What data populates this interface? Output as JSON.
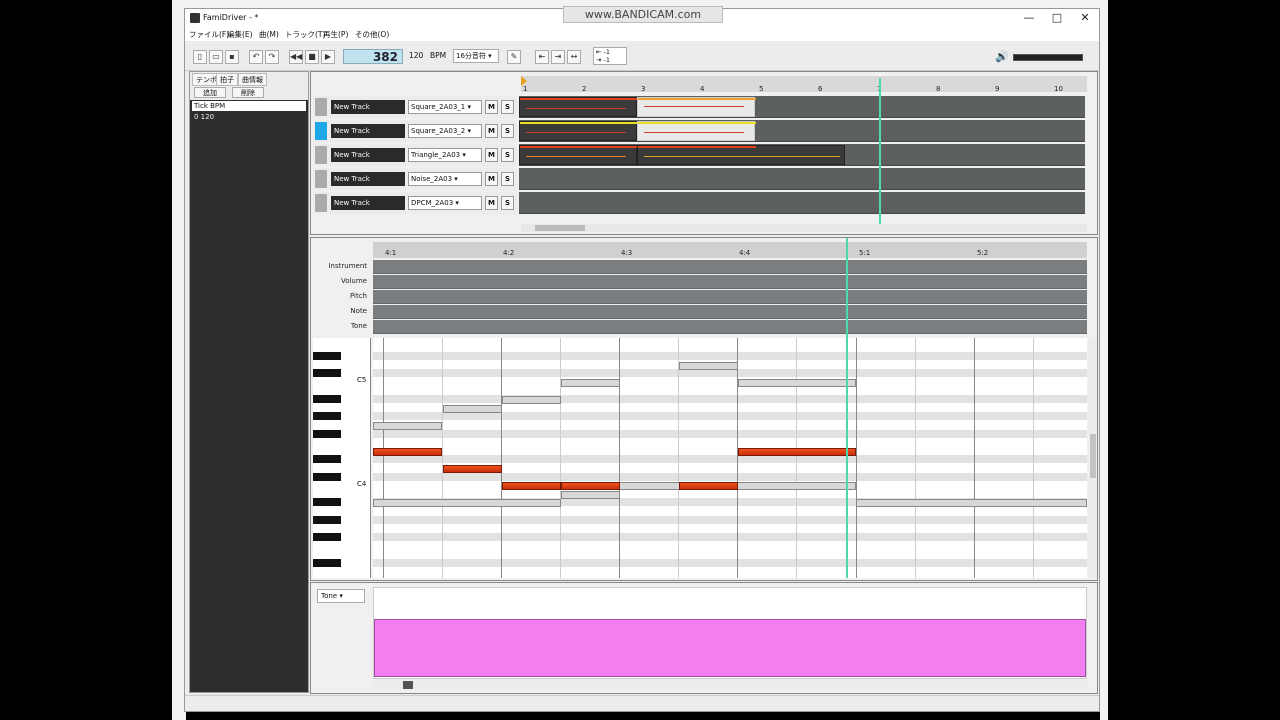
{
  "window": {
    "title": "FamiDriver - *",
    "minimize": "—",
    "maximize": "□",
    "close": "✕"
  },
  "overlay": {
    "bandicam": "www.BANDICAM.com"
  },
  "menu": [
    "ファイル(F)",
    "編集(E)",
    "曲(M)",
    "トラック(T)",
    "再生(P)",
    "その他(O)"
  ],
  "toolbar": {
    "position": "382",
    "bpm_value": "120",
    "bpm_label": "BPM",
    "grid": "16分音符",
    "shift_up": "-1",
    "shift_down": "-1"
  },
  "side": {
    "tabs": [
      "テンポ",
      "拍子",
      "曲情報"
    ],
    "add": "追加",
    "remove": "削除",
    "header": "Tick   BPM",
    "row": "0      120"
  },
  "timeline": {
    "measures": [
      "1",
      "2",
      "3",
      "4",
      "5",
      "6",
      "7",
      "8",
      "9",
      "10"
    ]
  },
  "tracks": [
    {
      "name": "New Track",
      "instrument": "Square_2A03_1",
      "mute": "M",
      "solo": "S"
    },
    {
      "name": "New Track",
      "instrument": "Square_2A03_2",
      "mute": "M",
      "solo": "S"
    },
    {
      "name": "New Track",
      "instrument": "Triangle_2A03",
      "mute": "M",
      "solo": "S"
    },
    {
      "name": "New Track",
      "instrument": "Noise_2A03",
      "mute": "M",
      "solo": "S"
    },
    {
      "name": "New Track",
      "instrument": "DPCM_2A03",
      "mute": "M",
      "solo": "S"
    }
  ],
  "pianoroll": {
    "beats": [
      "4:1",
      "4:2",
      "4:3",
      "4:4",
      "5:1",
      "5:2"
    ],
    "envelopes": [
      "Instrument",
      "Volume",
      "Pitch",
      "Note",
      "Tone"
    ],
    "key_labels": {
      "c5": "C5",
      "c4": "C4"
    }
  },
  "tone": {
    "selector": "Tone"
  },
  "colors": {
    "accent": "#4fd8a9",
    "note": "#e0401a",
    "tone": "#f27ef0",
    "selected_track": "#1fa8e8"
  }
}
